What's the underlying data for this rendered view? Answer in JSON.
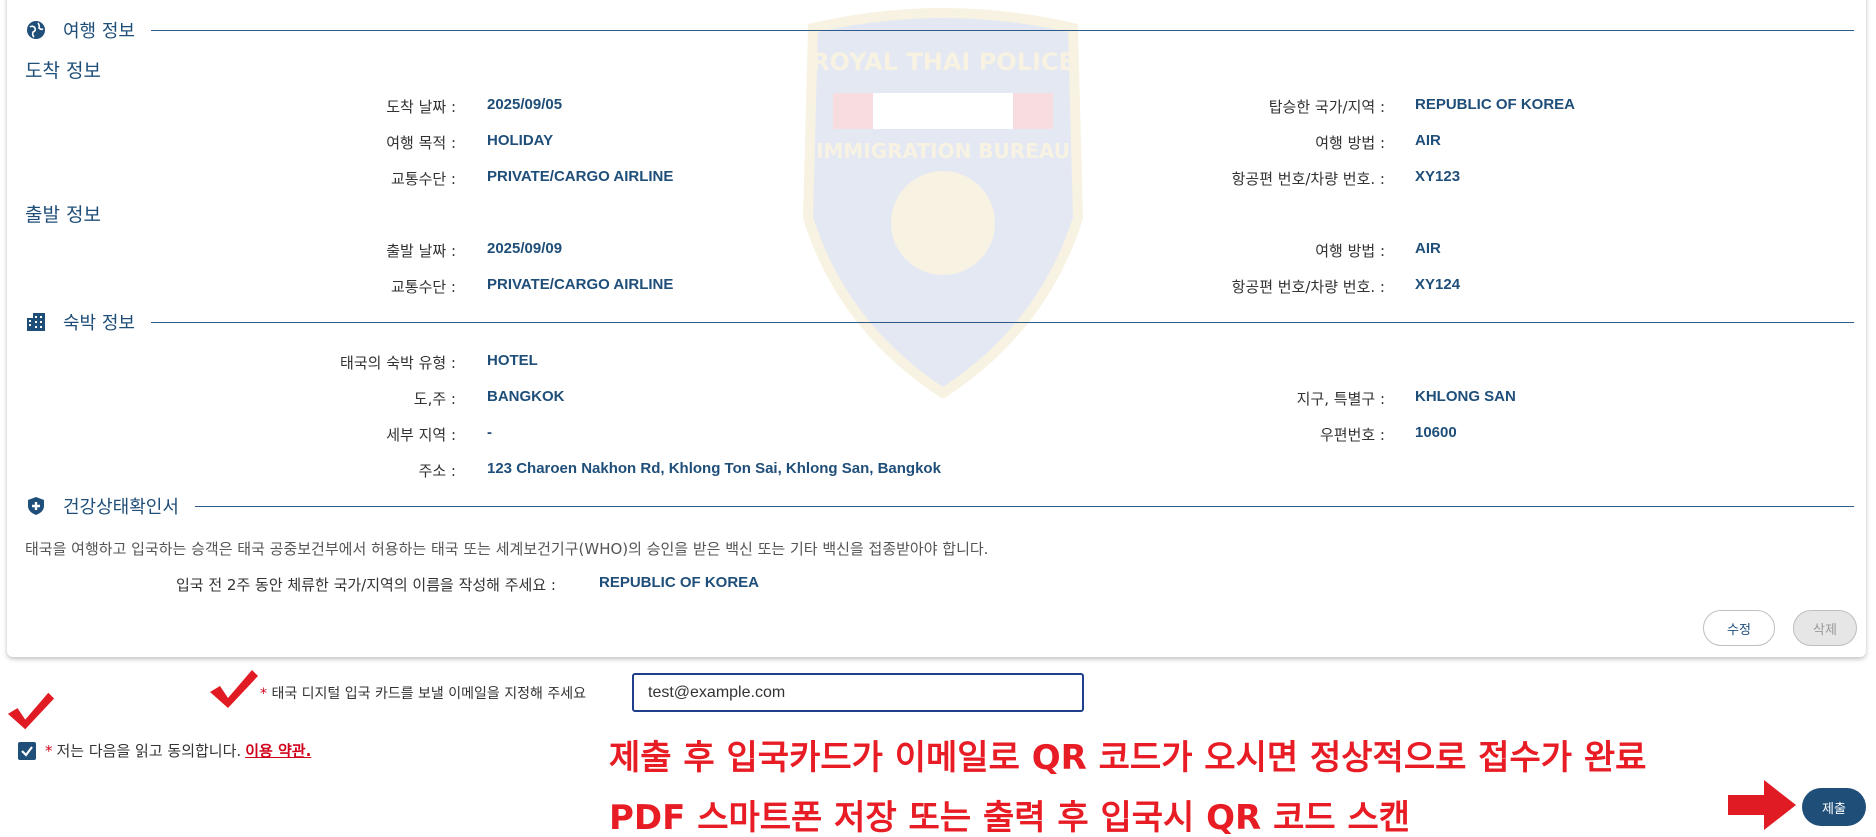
{
  "travel_section": {
    "title": "여행 정보",
    "icon": "globe-icon"
  },
  "arrival": {
    "title": "도착 정보",
    "fields": {
      "arrival_date": {
        "label": "도착 날짜 :",
        "value": "2025/09/05"
      },
      "boarded_country": {
        "label": "탑승한 국가/지역 :",
        "value": "REPUBLIC OF KOREA"
      },
      "purpose": {
        "label": "여행 목적 :",
        "value": "HOLIDAY"
      },
      "travel_mode": {
        "label": "여행 방법 :",
        "value": "AIR"
      },
      "transport": {
        "label": "교통수단 :",
        "value": "PRIVATE/CARGO AIRLINE"
      },
      "flight_no": {
        "label": "항공편 번호/차량 번호. :",
        "value": "XY123"
      }
    }
  },
  "departure": {
    "title": "출발 정보",
    "fields": {
      "departure_date": {
        "label": "출발 날짜 :",
        "value": "2025/09/09"
      },
      "travel_mode": {
        "label": "여행 방법 :",
        "value": "AIR"
      },
      "transport": {
        "label": "교통수단 :",
        "value": "PRIVATE/CARGO AIRLINE"
      },
      "flight_no": {
        "label": "항공편 번호/차량 번호. :",
        "value": "XY124"
      }
    }
  },
  "accommodation": {
    "title": "숙박 정보",
    "icon": "building-icon",
    "fields": {
      "type": {
        "label": "태국의 숙박 유형 :",
        "value": "HOTEL"
      },
      "province": {
        "label": "도,주 :",
        "value": "BANGKOK"
      },
      "district": {
        "label": "지구, 특별구 :",
        "value": "KHLONG SAN"
      },
      "subdistrict": {
        "label": "세부 지역 :",
        "value": "-"
      },
      "postcode": {
        "label": "우편번호 :",
        "value": "10600"
      },
      "address": {
        "label": "주소 :",
        "value": "123 Charoen Nakhon Rd, Khlong Ton Sai, Khlong San, Bangkok"
      }
    }
  },
  "health": {
    "title": "건강상태확인서",
    "icon": "shield-plus-icon",
    "note": "태국을 여행하고 입국하는 승객은 태국 공중보건부에서 허용하는 태국 또는 세계보건기구(WHO)의 승인을 받은 백신 또는 기타 백신을 접종받아야 합니다.",
    "countries": {
      "label": "입국 전 2주 동안 체류한 국가/지역의 이름을 작성해 주세요 :",
      "value": "REPUBLIC OF KOREA"
    }
  },
  "actions": {
    "edit": "수정",
    "delete": "삭제",
    "submit": "제출"
  },
  "email": {
    "required_mark": "*",
    "label": "태국 디지털 입국 카드를 보낼 이메일을 지정해 주세요",
    "value": "test@example.com"
  },
  "agreement": {
    "required_mark": "*",
    "text": "저는 다음을 읽고 동의합니다.",
    "terms_link": "이용 약관.",
    "checked": true
  },
  "overlay_notes": {
    "line1": "제출 후 입국카드가 이메일로 QR 코드가 오시면 정상적으로 접수가 완료",
    "line2": "PDF 스마트폰 저장 또는 출력 후 입국시 QR 코드 스캔"
  },
  "watermark": {
    "line1": "ROYAL THAI POLICE",
    "line2": "IMMIGRATION BUREAU"
  },
  "colors": {
    "primary": "#1f4e79",
    "accent_red": "#e81c24",
    "checkmark_red": "#e01b24"
  }
}
